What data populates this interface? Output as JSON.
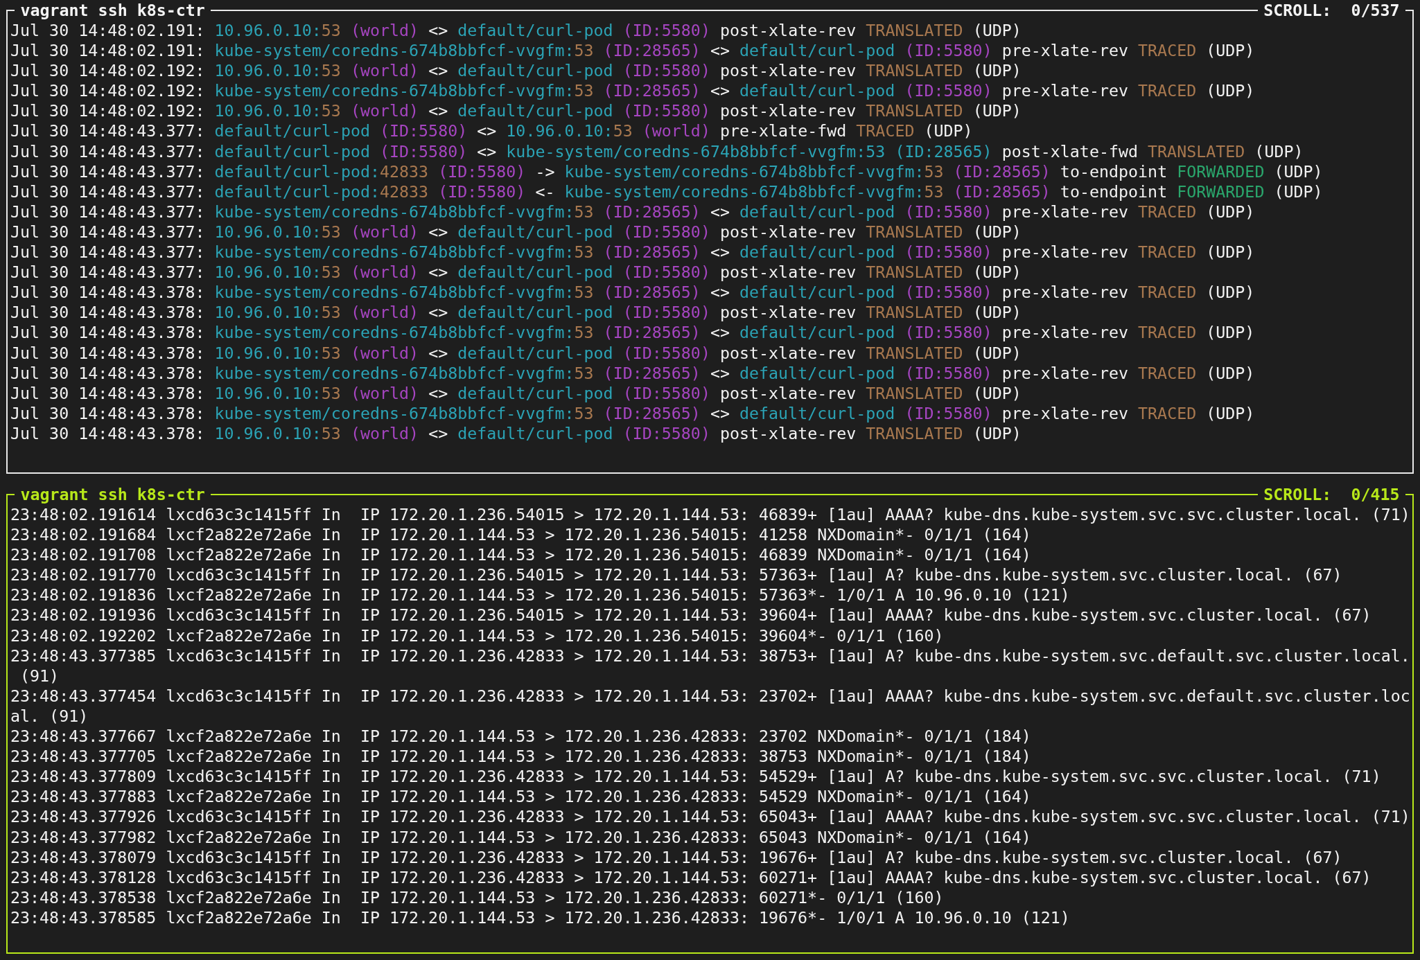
{
  "panes": [
    {
      "title": "vagrant ssh k8s-ctr",
      "scroll": "SCROLL:  0/537",
      "kind": "hubble",
      "lines": [
        [
          {
            "kind": "text",
            "text": "Jul 30 14:48:02.191: "
          },
          {
            "kind": "endpoint",
            "text": "10.96.0.10:"
          },
          {
            "kind": "port",
            "text": "53"
          },
          {
            "kind": "identity",
            "text": " (world)"
          },
          {
            "kind": "text",
            "text": " <> "
          },
          {
            "kind": "endpoint",
            "text": "default/curl-pod"
          },
          {
            "kind": "identity",
            "text": " (ID:5580)"
          },
          {
            "kind": "text",
            "text": " post-xlate-rev "
          },
          {
            "kind": "verdict",
            "color": "#a8784f",
            "text": "TRANSLATED"
          },
          {
            "kind": "text",
            "text": " (UDP)"
          }
        ],
        [
          {
            "kind": "text",
            "text": "Jul 30 14:48:02.191: "
          },
          {
            "kind": "endpoint",
            "text": "kube-system/coredns-674b8bbfcf-vvgfm:"
          },
          {
            "kind": "port",
            "text": "53"
          },
          {
            "kind": "identity",
            "text": " (ID:28565)"
          },
          {
            "kind": "text",
            "text": " <> "
          },
          {
            "kind": "endpoint",
            "text": "default/curl-pod"
          },
          {
            "kind": "identity",
            "text": " (ID:5580)"
          },
          {
            "kind": "text",
            "text": " pre-xlate-rev "
          },
          {
            "kind": "verdict",
            "color": "#a8784f",
            "text": "TRACED"
          },
          {
            "kind": "text",
            "text": " (UDP)"
          }
        ],
        [
          {
            "kind": "text",
            "text": "Jul 30 14:48:02.192: "
          },
          {
            "kind": "endpoint",
            "text": "10.96.0.10:"
          },
          {
            "kind": "port",
            "text": "53"
          },
          {
            "kind": "identity",
            "text": " (world)"
          },
          {
            "kind": "text",
            "text": " <> "
          },
          {
            "kind": "endpoint",
            "text": "default/curl-pod"
          },
          {
            "kind": "identity",
            "text": " (ID:5580)"
          },
          {
            "kind": "text",
            "text": " post-xlate-rev "
          },
          {
            "kind": "verdict",
            "color": "#a8784f",
            "text": "TRANSLATED"
          },
          {
            "kind": "text",
            "text": " (UDP)"
          }
        ],
        [
          {
            "kind": "text",
            "text": "Jul 30 14:48:02.192: "
          },
          {
            "kind": "endpoint",
            "text": "kube-system/coredns-674b8bbfcf-vvgfm:"
          },
          {
            "kind": "port",
            "text": "53"
          },
          {
            "kind": "identity",
            "text": " (ID:28565)"
          },
          {
            "kind": "text",
            "text": " <> "
          },
          {
            "kind": "endpoint",
            "text": "default/curl-pod"
          },
          {
            "kind": "identity",
            "text": " (ID:5580)"
          },
          {
            "kind": "text",
            "text": " pre-xlate-rev "
          },
          {
            "kind": "verdict",
            "color": "#a8784f",
            "text": "TRACED"
          },
          {
            "kind": "text",
            "text": " (UDP)"
          }
        ],
        [
          {
            "kind": "text",
            "text": "Jul 30 14:48:02.192: "
          },
          {
            "kind": "endpoint",
            "text": "10.96.0.10:"
          },
          {
            "kind": "port",
            "text": "53"
          },
          {
            "kind": "identity",
            "text": " (world)"
          },
          {
            "kind": "text",
            "text": " <> "
          },
          {
            "kind": "endpoint",
            "text": "default/curl-pod"
          },
          {
            "kind": "identity",
            "text": " (ID:5580)"
          },
          {
            "kind": "text",
            "text": " post-xlate-rev "
          },
          {
            "kind": "verdict",
            "color": "#a8784f",
            "text": "TRANSLATED"
          },
          {
            "kind": "text",
            "text": " (UDP)"
          }
        ],
        [
          {
            "kind": "text",
            "text": "Jul 30 14:48:43.377: "
          },
          {
            "kind": "endpoint",
            "text": "default/curl-pod"
          },
          {
            "kind": "identity",
            "text": " (ID:5580)"
          },
          {
            "kind": "text",
            "text": " <> "
          },
          {
            "kind": "endpoint",
            "text": "10.96.0.10:"
          },
          {
            "kind": "port",
            "text": "53"
          },
          {
            "kind": "identity",
            "text": " (world)"
          },
          {
            "kind": "text",
            "text": " pre-xlate-fwd "
          },
          {
            "kind": "verdict",
            "color": "#a8784f",
            "text": "TRACED"
          },
          {
            "kind": "text",
            "text": " (UDP)"
          }
        ],
        [
          {
            "kind": "text",
            "text": "Jul 30 14:48:43.377: "
          },
          {
            "kind": "endpoint",
            "text": "default/curl-pod"
          },
          {
            "kind": "identity",
            "text": " (ID:5580)"
          },
          {
            "kind": "text",
            "text": " <> "
          },
          {
            "kind": "endpoint",
            "text": "kube-system/coredns-674b8bbfcf-vvgfm:53 (ID:28565)"
          },
          {
            "kind": "text",
            "text": " post-xlate-fwd "
          },
          {
            "kind": "verdict",
            "color": "#a8784f",
            "text": "TRANSLATED"
          },
          {
            "kind": "text",
            "text": " (UDP)"
          }
        ],
        [
          {
            "kind": "text",
            "text": "Jul 30 14:48:43.377: "
          },
          {
            "kind": "endpoint",
            "text": "default/curl-pod:"
          },
          {
            "kind": "port",
            "text": "42833"
          },
          {
            "kind": "identity",
            "text": " (ID:5580)"
          },
          {
            "kind": "text",
            "text": " -> "
          },
          {
            "kind": "endpoint",
            "text": "kube-system/coredns-674b8bbfcf-vvgfm:"
          },
          {
            "kind": "port",
            "text": "53"
          },
          {
            "kind": "identity",
            "text": " (ID:28565)"
          },
          {
            "kind": "text",
            "text": " to-endpoint "
          },
          {
            "kind": "verdict",
            "color": "#2aa66c",
            "text": "FORWARDED"
          },
          {
            "kind": "text",
            "text": " (UDP)"
          }
        ],
        [
          {
            "kind": "text",
            "text": "Jul 30 14:48:43.377: "
          },
          {
            "kind": "endpoint",
            "text": "default/curl-pod:"
          },
          {
            "kind": "port",
            "text": "42833"
          },
          {
            "kind": "identity",
            "text": " (ID:5580)"
          },
          {
            "kind": "text",
            "text": " <- "
          },
          {
            "kind": "endpoint",
            "text": "kube-system/coredns-674b8bbfcf-vvgfm:"
          },
          {
            "kind": "port",
            "text": "53"
          },
          {
            "kind": "identity",
            "text": " (ID:28565)"
          },
          {
            "kind": "text",
            "text": " to-endpoint "
          },
          {
            "kind": "verdict",
            "color": "#2aa66c",
            "text": "FORWARDED"
          },
          {
            "kind": "text",
            "text": " (UDP)"
          }
        ],
        [
          {
            "kind": "text",
            "text": "Jul 30 14:48:43.377: "
          },
          {
            "kind": "endpoint",
            "text": "kube-system/coredns-674b8bbfcf-vvgfm:"
          },
          {
            "kind": "port",
            "text": "53"
          },
          {
            "kind": "identity",
            "text": " (ID:28565)"
          },
          {
            "kind": "text",
            "text": " <> "
          },
          {
            "kind": "endpoint",
            "text": "default/curl-pod"
          },
          {
            "kind": "identity",
            "text": " (ID:5580)"
          },
          {
            "kind": "text",
            "text": " pre-xlate-rev "
          },
          {
            "kind": "verdict",
            "color": "#a8784f",
            "text": "TRACED"
          },
          {
            "kind": "text",
            "text": " (UDP)"
          }
        ],
        [
          {
            "kind": "text",
            "text": "Jul 30 14:48:43.377: "
          },
          {
            "kind": "endpoint",
            "text": "10.96.0.10:"
          },
          {
            "kind": "port",
            "text": "53"
          },
          {
            "kind": "identity",
            "text": " (world)"
          },
          {
            "kind": "text",
            "text": " <> "
          },
          {
            "kind": "endpoint",
            "text": "default/curl-pod"
          },
          {
            "kind": "identity",
            "text": " (ID:5580)"
          },
          {
            "kind": "text",
            "text": " post-xlate-rev "
          },
          {
            "kind": "verdict",
            "color": "#a8784f",
            "text": "TRANSLATED"
          },
          {
            "kind": "text",
            "text": " (UDP)"
          }
        ],
        [
          {
            "kind": "text",
            "text": "Jul 30 14:48:43.377: "
          },
          {
            "kind": "endpoint",
            "text": "kube-system/coredns-674b8bbfcf-vvgfm:"
          },
          {
            "kind": "port",
            "text": "53"
          },
          {
            "kind": "identity",
            "text": " (ID:28565)"
          },
          {
            "kind": "text",
            "text": " <> "
          },
          {
            "kind": "endpoint",
            "text": "default/curl-pod"
          },
          {
            "kind": "identity",
            "text": " (ID:5580)"
          },
          {
            "kind": "text",
            "text": " pre-xlate-rev "
          },
          {
            "kind": "verdict",
            "color": "#a8784f",
            "text": "TRACED"
          },
          {
            "kind": "text",
            "text": " (UDP)"
          }
        ],
        [
          {
            "kind": "text",
            "text": "Jul 30 14:48:43.377: "
          },
          {
            "kind": "endpoint",
            "text": "10.96.0.10:"
          },
          {
            "kind": "port",
            "text": "53"
          },
          {
            "kind": "identity",
            "text": " (world)"
          },
          {
            "kind": "text",
            "text": " <> "
          },
          {
            "kind": "endpoint",
            "text": "default/curl-pod"
          },
          {
            "kind": "identity",
            "text": " (ID:5580)"
          },
          {
            "kind": "text",
            "text": " post-xlate-rev "
          },
          {
            "kind": "verdict",
            "color": "#a8784f",
            "text": "TRANSLATED"
          },
          {
            "kind": "text",
            "text": " (UDP)"
          }
        ],
        [
          {
            "kind": "text",
            "text": "Jul 30 14:48:43.378: "
          },
          {
            "kind": "endpoint",
            "text": "kube-system/coredns-674b8bbfcf-vvgfm:"
          },
          {
            "kind": "port",
            "text": "53"
          },
          {
            "kind": "identity",
            "text": " (ID:28565)"
          },
          {
            "kind": "text",
            "text": " <> "
          },
          {
            "kind": "endpoint",
            "text": "default/curl-pod"
          },
          {
            "kind": "identity",
            "text": " (ID:5580)"
          },
          {
            "kind": "text",
            "text": " pre-xlate-rev "
          },
          {
            "kind": "verdict",
            "color": "#a8784f",
            "text": "TRACED"
          },
          {
            "kind": "text",
            "text": " (UDP)"
          }
        ],
        [
          {
            "kind": "text",
            "text": "Jul 30 14:48:43.378: "
          },
          {
            "kind": "endpoint",
            "text": "10.96.0.10:"
          },
          {
            "kind": "port",
            "text": "53"
          },
          {
            "kind": "identity",
            "text": " (world)"
          },
          {
            "kind": "text",
            "text": " <> "
          },
          {
            "kind": "endpoint",
            "text": "default/curl-pod"
          },
          {
            "kind": "identity",
            "text": " (ID:5580)"
          },
          {
            "kind": "text",
            "text": " post-xlate-rev "
          },
          {
            "kind": "verdict",
            "color": "#a8784f",
            "text": "TRANSLATED"
          },
          {
            "kind": "text",
            "text": " (UDP)"
          }
        ],
        [
          {
            "kind": "text",
            "text": "Jul 30 14:48:43.378: "
          },
          {
            "kind": "endpoint",
            "text": "kube-system/coredns-674b8bbfcf-vvgfm:"
          },
          {
            "kind": "port",
            "text": "53"
          },
          {
            "kind": "identity",
            "text": " (ID:28565)"
          },
          {
            "kind": "text",
            "text": " <> "
          },
          {
            "kind": "endpoint",
            "text": "default/curl-pod"
          },
          {
            "kind": "identity",
            "text": " (ID:5580)"
          },
          {
            "kind": "text",
            "text": " pre-xlate-rev "
          },
          {
            "kind": "verdict",
            "color": "#a8784f",
            "text": "TRACED"
          },
          {
            "kind": "text",
            "text": " (UDP)"
          }
        ],
        [
          {
            "kind": "text",
            "text": "Jul 30 14:48:43.378: "
          },
          {
            "kind": "endpoint",
            "text": "10.96.0.10:"
          },
          {
            "kind": "port",
            "text": "53"
          },
          {
            "kind": "identity",
            "text": " (world)"
          },
          {
            "kind": "text",
            "text": " <> "
          },
          {
            "kind": "endpoint",
            "text": "default/curl-pod"
          },
          {
            "kind": "identity",
            "text": " (ID:5580)"
          },
          {
            "kind": "text",
            "text": " post-xlate-rev "
          },
          {
            "kind": "verdict",
            "color": "#a8784f",
            "text": "TRANSLATED"
          },
          {
            "kind": "text",
            "text": " (UDP)"
          }
        ],
        [
          {
            "kind": "text",
            "text": "Jul 30 14:48:43.378: "
          },
          {
            "kind": "endpoint",
            "text": "kube-system/coredns-674b8bbfcf-vvgfm:"
          },
          {
            "kind": "port",
            "text": "53"
          },
          {
            "kind": "identity",
            "text": " (ID:28565)"
          },
          {
            "kind": "text",
            "text": " <> "
          },
          {
            "kind": "endpoint",
            "text": "default/curl-pod"
          },
          {
            "kind": "identity",
            "text": " (ID:5580)"
          },
          {
            "kind": "text",
            "text": " pre-xlate-rev "
          },
          {
            "kind": "verdict",
            "color": "#a8784f",
            "text": "TRACED"
          },
          {
            "kind": "text",
            "text": " (UDP)"
          }
        ],
        [
          {
            "kind": "text",
            "text": "Jul 30 14:48:43.378: "
          },
          {
            "kind": "endpoint",
            "text": "10.96.0.10:"
          },
          {
            "kind": "port",
            "text": "53"
          },
          {
            "kind": "identity",
            "text": " (world)"
          },
          {
            "kind": "text",
            "text": " <> "
          },
          {
            "kind": "endpoint",
            "text": "default/curl-pod"
          },
          {
            "kind": "identity",
            "text": " (ID:5580)"
          },
          {
            "kind": "text",
            "text": " post-xlate-rev "
          },
          {
            "kind": "verdict",
            "color": "#a8784f",
            "text": "TRANSLATED"
          },
          {
            "kind": "text",
            "text": " (UDP)"
          }
        ],
        [
          {
            "kind": "text",
            "text": "Jul 30 14:48:43.378: "
          },
          {
            "kind": "endpoint",
            "text": "kube-system/coredns-674b8bbfcf-vvgfm:"
          },
          {
            "kind": "port",
            "text": "53"
          },
          {
            "kind": "identity",
            "text": " (ID:28565)"
          },
          {
            "kind": "text",
            "text": " <> "
          },
          {
            "kind": "endpoint",
            "text": "default/curl-pod"
          },
          {
            "kind": "identity",
            "text": " (ID:5580)"
          },
          {
            "kind": "text",
            "text": " pre-xlate-rev "
          },
          {
            "kind": "verdict",
            "color": "#a8784f",
            "text": "TRACED"
          },
          {
            "kind": "text",
            "text": " (UDP)"
          }
        ],
        [
          {
            "kind": "text",
            "text": "Jul 30 14:48:43.378: "
          },
          {
            "kind": "endpoint",
            "text": "10.96.0.10:"
          },
          {
            "kind": "port",
            "text": "53"
          },
          {
            "kind": "identity",
            "text": " (world)"
          },
          {
            "kind": "text",
            "text": " <> "
          },
          {
            "kind": "endpoint",
            "text": "default/curl-pod"
          },
          {
            "kind": "identity",
            "text": " (ID:5580)"
          },
          {
            "kind": "text",
            "text": " post-xlate-rev "
          },
          {
            "kind": "verdict",
            "color": "#a8784f",
            "text": "TRANSLATED"
          },
          {
            "kind": "text",
            "text": " (UDP)"
          }
        ]
      ]
    },
    {
      "title": "vagrant ssh k8s-ctr",
      "scroll": "SCROLL:  0/415",
      "kind": "tcpdump",
      "focused": true,
      "lines": [
        "23:48:02.191614 lxcd63c3c1415ff In  IP 172.20.1.236.54015 > 172.20.1.144.53: 46839+ [1au] AAAA? kube-dns.kube-system.svc.svc.cluster.local. (71)",
        "23:48:02.191684 lxcf2a822e72a6e In  IP 172.20.1.144.53 > 172.20.1.236.54015: 41258 NXDomain*- 0/1/1 (164)",
        "23:48:02.191708 lxcf2a822e72a6e In  IP 172.20.1.144.53 > 172.20.1.236.54015: 46839 NXDomain*- 0/1/1 (164)",
        "23:48:02.191770 lxcd63c3c1415ff In  IP 172.20.1.236.54015 > 172.20.1.144.53: 57363+ [1au] A? kube-dns.kube-system.svc.cluster.local. (67)",
        "23:48:02.191836 lxcf2a822e72a6e In  IP 172.20.1.144.53 > 172.20.1.236.54015: 57363*- 1/0/1 A 10.96.0.10 (121)",
        "23:48:02.191936 lxcd63c3c1415ff In  IP 172.20.1.236.54015 > 172.20.1.144.53: 39604+ [1au] AAAA? kube-dns.kube-system.svc.cluster.local. (67)",
        "23:48:02.192202 lxcf2a822e72a6e In  IP 172.20.1.144.53 > 172.20.1.236.54015: 39604*- 0/1/1 (160)",
        "23:48:43.377385 lxcd63c3c1415ff In  IP 172.20.1.236.42833 > 172.20.1.144.53: 38753+ [1au] A? kube-dns.kube-system.svc.default.svc.cluster.local. (91)",
        "23:48:43.377454 lxcd63c3c1415ff In  IP 172.20.1.236.42833 > 172.20.1.144.53: 23702+ [1au] AAAA? kube-dns.kube-system.svc.default.svc.cluster.local. (91)",
        "23:48:43.377667 lxcf2a822e72a6e In  IP 172.20.1.144.53 > 172.20.1.236.42833: 23702 NXDomain*- 0/1/1 (184)",
        "23:48:43.377705 lxcf2a822e72a6e In  IP 172.20.1.144.53 > 172.20.1.236.42833: 38753 NXDomain*- 0/1/1 (184)",
        "23:48:43.377809 lxcd63c3c1415ff In  IP 172.20.1.236.42833 > 172.20.1.144.53: 54529+ [1au] A? kube-dns.kube-system.svc.svc.cluster.local. (71)",
        "23:48:43.377883 lxcf2a822e72a6e In  IP 172.20.1.144.53 > 172.20.1.236.42833: 54529 NXDomain*- 0/1/1 (164)",
        "23:48:43.377926 lxcd63c3c1415ff In  IP 172.20.1.236.42833 > 172.20.1.144.53: 65043+ [1au] AAAA? kube-dns.kube-system.svc.svc.cluster.local. (71)",
        "23:48:43.377982 lxcf2a822e72a6e In  IP 172.20.1.144.53 > 172.20.1.236.42833: 65043 NXDomain*- 0/1/1 (164)",
        "23:48:43.378079 lxcd63c3c1415ff In  IP 172.20.1.236.42833 > 172.20.1.144.53: 19676+ [1au] A? kube-dns.kube-system.svc.cluster.local. (67)",
        "23:48:43.378128 lxcd63c3c1415ff In  IP 172.20.1.236.42833 > 172.20.1.144.53: 60271+ [1au] AAAA? kube-dns.kube-system.svc.cluster.local. (67)",
        "23:48:43.378538 lxcf2a822e72a6e In  IP 172.20.1.144.53 > 172.20.1.236.42833: 60271*- 0/1/1 (160)",
        "23:48:43.378585 lxcf2a822e72a6e In  IP 172.20.1.144.53 > 172.20.1.236.42833: 19676*- 1/0/1 A 10.96.0.10 (121)"
      ]
    }
  ]
}
